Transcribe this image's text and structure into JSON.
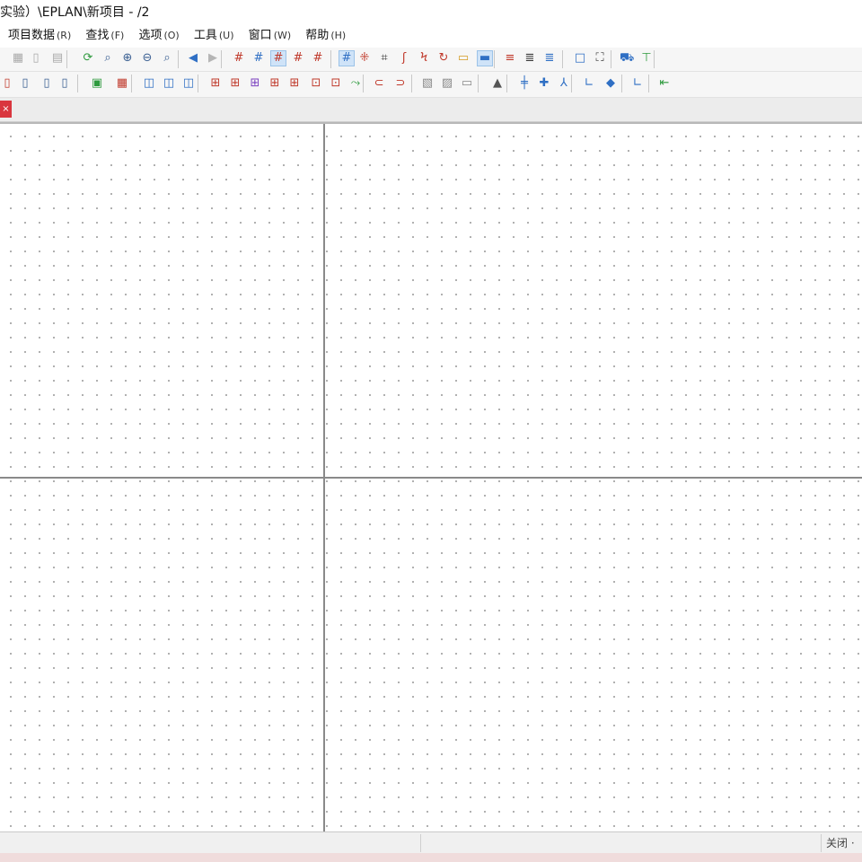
{
  "titlebar": {
    "text": "实验）\\EPLAN\\新项目 - /2"
  },
  "menu": [
    {
      "label": "项目数据",
      "mnemonic": "(R)"
    },
    {
      "label": "查找",
      "mnemonic": "(F)"
    },
    {
      "label": "选项",
      "mnemonic": "(O)"
    },
    {
      "label": "工具",
      "mnemonic": "(U)"
    },
    {
      "label": "窗口",
      "mnemonic": "(W)"
    },
    {
      "label": "帮助",
      "mnemonic": "(H)"
    }
  ],
  "toolbar1": [
    {
      "icon": "grid-icon",
      "glyph": "▦",
      "color": "#aaaaaa"
    },
    {
      "icon": "page-icon",
      "glyph": "▯",
      "color": "#aaaaaa"
    },
    {
      "icon": "page-list-icon",
      "glyph": "▤",
      "color": "#aaaaaa"
    },
    {
      "icon": "refresh-icon",
      "glyph": "⟳",
      "color": "#2e9a3e"
    },
    {
      "icon": "zoom-window-icon",
      "glyph": "⌕",
      "color": "#3a5f92"
    },
    {
      "icon": "zoom-in-icon",
      "glyph": "⊕",
      "color": "#3a5f92"
    },
    {
      "icon": "zoom-out-icon",
      "glyph": "⊖",
      "color": "#3a5f92"
    },
    {
      "icon": "zoom-all-icon",
      "glyph": "⌕",
      "color": "#3a5f92"
    },
    {
      "icon": "arrow-back-icon",
      "glyph": "◀",
      "color": "#2f6fc4"
    },
    {
      "icon": "arrow-forward-icon",
      "glyph": "▶",
      "color": "#b5b5b5"
    },
    {
      "icon": "grid-a-icon",
      "glyph": "#",
      "color": "#c0392b"
    },
    {
      "icon": "grid-b-icon",
      "glyph": "#",
      "color": "#2f6fc4"
    },
    {
      "icon": "grid-c-icon",
      "glyph": "#",
      "color": "#c0392b",
      "active": true
    },
    {
      "icon": "grid-d-icon",
      "glyph": "#",
      "color": "#c0392b"
    },
    {
      "icon": "grid-e-icon",
      "glyph": "#",
      "color": "#c0392b"
    },
    {
      "icon": "snap-grid-icon",
      "glyph": "#",
      "color": "#2f6fc4",
      "active": true
    },
    {
      "icon": "snap-object-icon",
      "glyph": "⁜",
      "color": "#c0392b"
    },
    {
      "icon": "crosshair-icon",
      "glyph": "⌗",
      "color": "#3a3a3a"
    },
    {
      "icon": "symbol-a-icon",
      "glyph": "ʃ",
      "color": "#c0392b"
    },
    {
      "icon": "symbol-b-icon",
      "glyph": "Ϟ",
      "color": "#c0392b"
    },
    {
      "icon": "symbol-c-icon",
      "glyph": "↻",
      "color": "#c0392b"
    },
    {
      "icon": "symbol-d-icon",
      "glyph": "▭",
      "color": "#d49b22"
    },
    {
      "icon": "line-icon",
      "glyph": "▬",
      "color": "#2f6fc4",
      "active": true
    },
    {
      "icon": "text-a-icon",
      "glyph": "≡",
      "color": "#c0392b"
    },
    {
      "icon": "text-b-icon",
      "glyph": "≣",
      "color": "#3a3a3a"
    },
    {
      "icon": "text-c-icon",
      "glyph": "≣",
      "color": "#2f6fc4"
    },
    {
      "icon": "select-icon",
      "glyph": "□",
      "color": "#2f6fc4"
    },
    {
      "icon": "fit-icon",
      "glyph": "⛶",
      "color": "#3a3a3a"
    },
    {
      "icon": "cart-icon",
      "glyph": "⛟",
      "color": "#2f6fc4"
    },
    {
      "icon": "terminal-icon",
      "glyph": "⊤",
      "color": "#2e9a3e"
    }
  ],
  "toolbar2": [
    {
      "icon": "new-page-icon",
      "glyph": "▯",
      "color": "#c0392b"
    },
    {
      "icon": "open-page-icon",
      "glyph": "▯",
      "color": "#3a5f92"
    },
    {
      "icon": "page-prev-icon",
      "glyph": "▯",
      "color": "#3a5f92"
    },
    {
      "icon": "page-next-icon",
      "glyph": "▯",
      "color": "#3a5f92"
    },
    {
      "icon": "image-icon",
      "glyph": "▣",
      "color": "#2e9a3e"
    },
    {
      "icon": "table-icon",
      "glyph": "▦",
      "color": "#c0392b"
    },
    {
      "icon": "macro-a-icon",
      "glyph": "◫",
      "color": "#2f6fc4"
    },
    {
      "icon": "macro-b-icon",
      "glyph": "◫",
      "color": "#2f6fc4"
    },
    {
      "icon": "macro-c-icon",
      "glyph": "◫",
      "color": "#2f6fc4"
    },
    {
      "icon": "device-a-icon",
      "glyph": "⊞",
      "color": "#c0392b"
    },
    {
      "icon": "device-b-icon",
      "glyph": "⊞",
      "color": "#c0392b"
    },
    {
      "icon": "device-c-icon",
      "glyph": "⊞",
      "color": "#7a3fbf"
    },
    {
      "icon": "device-d-icon",
      "glyph": "⊞",
      "color": "#c0392b"
    },
    {
      "icon": "device-e-icon",
      "glyph": "⊞",
      "color": "#c0392b"
    },
    {
      "icon": "device-f-icon",
      "glyph": "⊡",
      "color": "#c0392b"
    },
    {
      "icon": "device-g-icon",
      "glyph": "⊡",
      "color": "#c0392b"
    },
    {
      "icon": "connect-icon",
      "glyph": "⤳",
      "color": "#2e9a3e"
    },
    {
      "icon": "plug-a-icon",
      "glyph": "⊂",
      "color": "#c0392b"
    },
    {
      "icon": "plug-b-icon",
      "glyph": "⊃",
      "color": "#c0392b"
    },
    {
      "icon": "hatch-a-icon",
      "glyph": "▧",
      "color": "#888888"
    },
    {
      "icon": "hatch-b-icon",
      "glyph": "▨",
      "color": "#888888"
    },
    {
      "icon": "rect-icon",
      "glyph": "▭",
      "color": "#888888"
    },
    {
      "icon": "triangle-icon",
      "glyph": "▲",
      "color": "#555555"
    },
    {
      "icon": "bus-icon",
      "glyph": "╪",
      "color": "#2f6fc4"
    },
    {
      "icon": "cross-icon",
      "glyph": "✚",
      "color": "#2f6fc4"
    },
    {
      "icon": "split-icon",
      "glyph": "⅄",
      "color": "#2f6fc4"
    },
    {
      "icon": "angle-icon",
      "glyph": "∟",
      "color": "#2f6fc4"
    },
    {
      "icon": "diamond-icon",
      "glyph": "◆",
      "color": "#2f6fc4"
    },
    {
      "icon": "angle-b-icon",
      "glyph": "∟",
      "color": "#2f6fc4"
    },
    {
      "icon": "arrow-connect-icon",
      "glyph": "⇤",
      "color": "#2e9a3e"
    }
  ],
  "tab": {
    "close_glyph": "×"
  },
  "status": {
    "right_text": "关闭 ·"
  }
}
